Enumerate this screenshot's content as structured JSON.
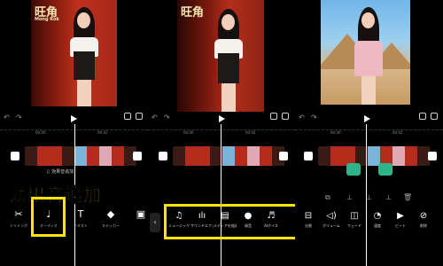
{
  "caption": {
    "text": "効果音追加"
  },
  "panels": [
    {
      "preview": {
        "sign_big": "旺角",
        "sign_small": "Mong Kok"
      },
      "ruler": [
        "00:00",
        "00:02"
      ],
      "audio_label": "♫ 効果音追加",
      "toolbar": [
        {
          "icon": "scissors-icon",
          "glyph": "✂",
          "label": "トリミング"
        },
        {
          "icon": "music-note-icon",
          "glyph": "♩",
          "label": "オーディオ"
        },
        {
          "icon": "text-icon",
          "glyph": "T",
          "label": "テキスト"
        },
        {
          "icon": "sticker-icon",
          "glyph": "◆",
          "label": "ステッカー"
        },
        {
          "icon": "image-icon",
          "glyph": "▣",
          "label": ""
        }
      ]
    },
    {
      "preview": {
        "sign_big": "旺角",
        "sign_small": ""
      },
      "ruler": [
        "00:00",
        "00:02"
      ],
      "toolbar": [
        {
          "icon": "music-icon",
          "glyph": "♫",
          "label": "ミュージック"
        },
        {
          "icon": "sound-effect-icon",
          "glyph": "ılı",
          "label": "サウンドエフェクト"
        },
        {
          "icon": "extract-audio-icon",
          "glyph": "▤",
          "label": "メディアを抽出"
        },
        {
          "icon": "microphone-icon",
          "glyph": "●",
          "label": "録音"
        },
        {
          "icon": "ai-voice-icon",
          "glyph": "♬",
          "label": "AIボイス"
        }
      ]
    },
    {
      "preview": {
        "sign_big": "",
        "sign_small": ""
      },
      "ruler": [
        "00:00",
        "00:02"
      ],
      "mini_icons": [
        "⧉",
        "⊥",
        "⊥",
        "⊥",
        "🗑"
      ],
      "toolbar": [
        {
          "icon": "split-icon",
          "glyph": "⊟",
          "label": "分割"
        },
        {
          "icon": "volume-icon",
          "glyph": "◁)",
          "label": "ボリューム"
        },
        {
          "icon": "fade-icon",
          "glyph": "◫",
          "label": "フェード"
        },
        {
          "icon": "speed-icon",
          "glyph": "◔",
          "label": "速度"
        },
        {
          "icon": "beat-icon",
          "glyph": "▶",
          "label": "ビート"
        },
        {
          "icon": "delete-icon",
          "glyph": "⊘",
          "label": "削除"
        }
      ]
    }
  ],
  "colors": {
    "highlight": "#ffe400",
    "sticker": "#2fb38a"
  }
}
